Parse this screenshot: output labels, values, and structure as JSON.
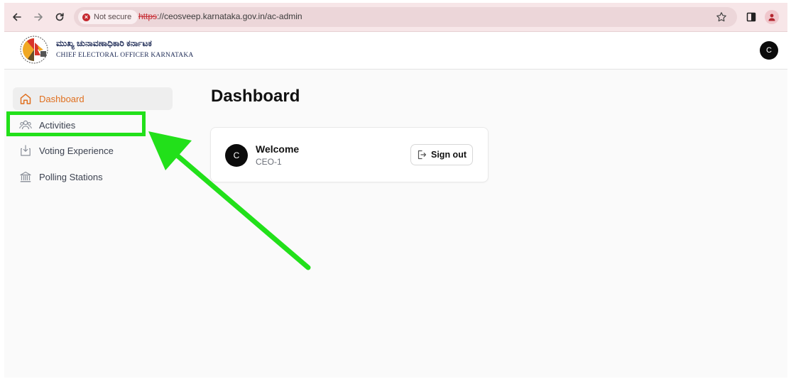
{
  "browser": {
    "security_label": "Not secure",
    "url_scheme": "https",
    "url_rest": "://ceosveep.karnataka.gov.in/ac-admin"
  },
  "site": {
    "brand_kannada": "ಮುಖ್ಯ ಚುನಾವಣಾಧಿಕಾರಿ ಕರ್ನಾಟಕ",
    "brand_english": "CHIEF ELECTORAL OFFICER KARNATAKA",
    "avatar_letter": "C"
  },
  "sidebar": {
    "items": [
      {
        "label": "Dashboard",
        "icon": "home-icon",
        "active": true
      },
      {
        "label": "Activities",
        "icon": "users-icon",
        "active": false
      },
      {
        "label": "Voting Experience",
        "icon": "ballot-icon",
        "active": false
      },
      {
        "label": "Polling Stations",
        "icon": "building-icon",
        "active": false
      }
    ]
  },
  "main": {
    "title": "Dashboard",
    "welcome_card": {
      "avatar_letter": "C",
      "title": "Welcome",
      "subtitle": "CEO-1",
      "signout_label": "Sign out"
    }
  },
  "colors": {
    "accent": "#e0701f",
    "annotation": "#22e01a",
    "chrome": "#f7e6e8"
  }
}
